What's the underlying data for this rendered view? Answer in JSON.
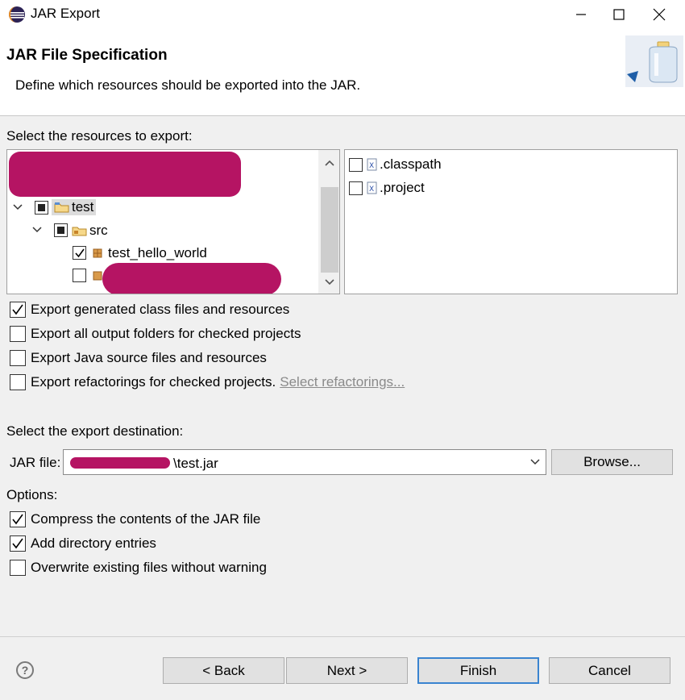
{
  "window": {
    "title": "JAR Export"
  },
  "header": {
    "title": "JAR File Specification",
    "description": "Define which resources should be exported into the JAR."
  },
  "resources": {
    "label": "Select the resources to export:",
    "tree": [
      {
        "label": "test",
        "state": "partial",
        "expanded": true
      },
      {
        "label": "src",
        "state": "partial",
        "expanded": true
      },
      {
        "label": "test_hello_world",
        "state": "checked"
      }
    ],
    "files": [
      {
        "label": ".classpath",
        "checked": false
      },
      {
        "label": ".project",
        "checked": false
      }
    ]
  },
  "export_options": [
    {
      "label": "Export generated class files and resources",
      "checked": true
    },
    {
      "label": "Export all output folders for checked projects",
      "checked": false
    },
    {
      "label": "Export Java source files and resources",
      "checked": false
    },
    {
      "label": "Export refactorings for checked projects.",
      "checked": false
    }
  ],
  "refactorings_link": "Select refactorings...",
  "destination": {
    "label": "Select the export destination:",
    "jar_label": "JAR file:",
    "jar_value": "\\test.jar",
    "browse_label": "Browse..."
  },
  "options": {
    "label": "Options:",
    "items": [
      {
        "label": "Compress the contents of the JAR file",
        "checked": true
      },
      {
        "label": "Add directory entries",
        "checked": true
      },
      {
        "label": "Overwrite existing files without warning",
        "checked": false
      }
    ]
  },
  "footer": {
    "help_glyph": "?",
    "back_label": "< Back",
    "next_label": "Next >",
    "finish_label": "Finish",
    "cancel_label": "Cancel"
  },
  "colors": {
    "redaction": "#b51463",
    "default_button_border": "#3a84d0"
  }
}
